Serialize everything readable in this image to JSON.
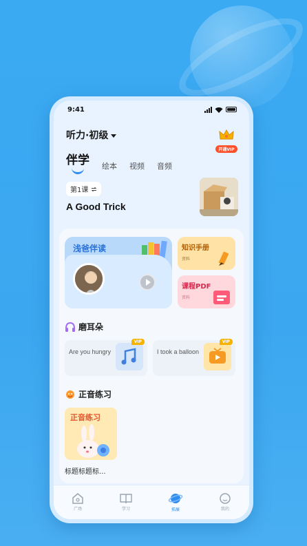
{
  "status_bar": {
    "time": "9:41"
  },
  "header": {
    "level": "听力·初级",
    "vip_label": "开通VIP"
  },
  "tabs": [
    {
      "label": "伴学",
      "active": true
    },
    {
      "label": "绘本"
    },
    {
      "label": "视频"
    },
    {
      "label": "音频"
    }
  ],
  "lesson": {
    "number": "第1课",
    "switch_icon": "swap-icon",
    "title": "A Good Trick"
  },
  "reader_card": {
    "title": "浅爸伴读"
  },
  "side_cards": [
    {
      "title": "知识手册",
      "sub": "资料"
    },
    {
      "title": "课程PDF",
      "sub": "资料"
    }
  ],
  "section_listen": {
    "title": "磨耳朵"
  },
  "audio_items": [
    {
      "text": "Are you hungry",
      "tag": "VIP"
    },
    {
      "text": "I took a balloon",
      "tag": "VIP"
    }
  ],
  "section_practice": {
    "title": "正音练习"
  },
  "practice_card": {
    "label": "正音练习",
    "caption": "标题标题标..."
  },
  "tabbar": [
    {
      "label": "广场",
      "icon": "home-icon"
    },
    {
      "label": "学习",
      "icon": "book-icon"
    },
    {
      "label": "拓展",
      "icon": "planet-icon",
      "active": true
    },
    {
      "label": "我的",
      "icon": "face-icon"
    }
  ],
  "colors": {
    "accent": "#2f8cf0",
    "background": "#3aaaf3",
    "vip": "#f5b300"
  }
}
